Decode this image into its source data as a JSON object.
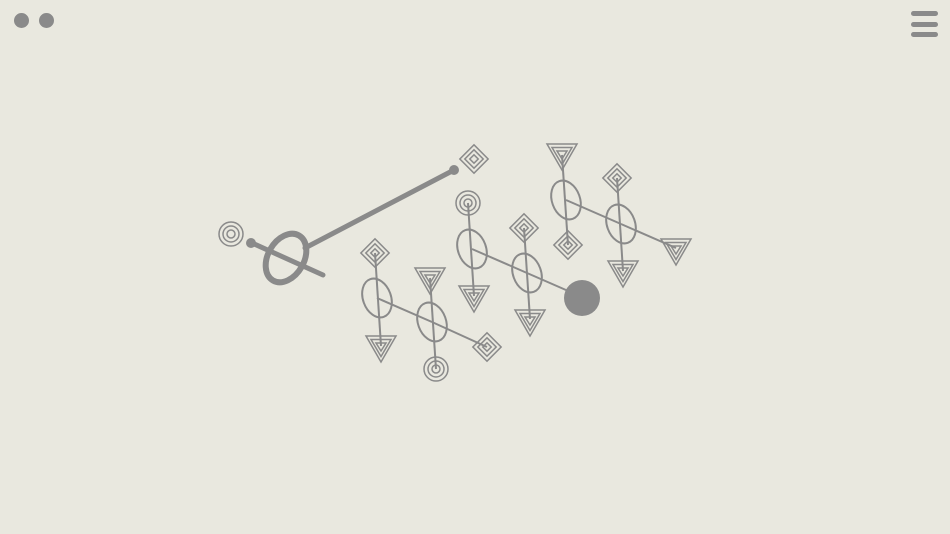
{
  "colors": {
    "background": "#e9e8df",
    "ink": "#8a8a8a"
  },
  "hud": {
    "level_dots": [
      "dot",
      "dot"
    ],
    "menu_icon": "hamburger-menu-icon"
  },
  "puzzle": {
    "active_rod": {
      "ring_icon": "ellipse-rotor-icon",
      "start_node": "spiral-circle-node",
      "end_node": "spiral-diamond-node"
    },
    "rotors": [
      {
        "id": "r1",
        "icon": "ellipse-rotor-icon",
        "ends": [
          "spiral-diamond-node",
          "spiral-triangle-node"
        ]
      },
      {
        "id": "r2",
        "icon": "ellipse-rotor-icon",
        "ends": [
          "spiral-triangle-node",
          "spiral-circle-node"
        ]
      },
      {
        "id": "r3",
        "icon": "ellipse-rotor-icon",
        "ends": [
          "spiral-circle-node",
          "spiral-triangle-node"
        ]
      },
      {
        "id": "r4",
        "icon": "ellipse-rotor-icon",
        "ends": [
          "spiral-diamond-node",
          "spiral-triangle-node"
        ]
      },
      {
        "id": "r5",
        "icon": "ellipse-rotor-icon",
        "ends": [
          "spiral-triangle-node",
          "spiral-diamond-node"
        ]
      },
      {
        "id": "r6",
        "icon": "ellipse-rotor-icon",
        "ends": [
          "spiral-diamond-node",
          "spiral-triangle-node"
        ]
      }
    ],
    "goal": "solid-circle-goal"
  }
}
